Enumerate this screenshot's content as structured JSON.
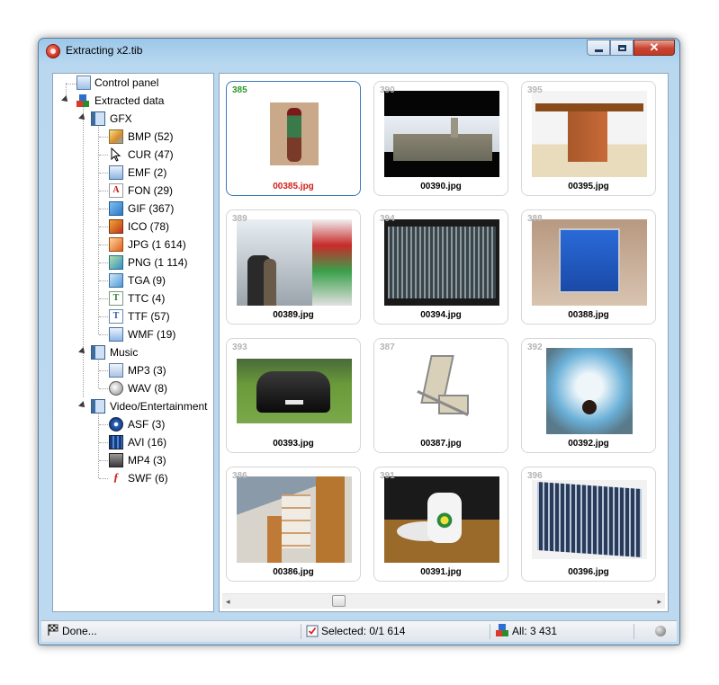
{
  "window": {
    "title": "Extracting x2.tib"
  },
  "tree": {
    "control_panel": "Control panel",
    "extracted_data": "Extracted data",
    "gfx": {
      "label": "GFX",
      "items": [
        "BMP (52)",
        "CUR (47)",
        "EMF (2)",
        "FON (29)",
        "GIF (367)",
        "ICO (78)",
        "JPG (1 614)",
        "PNG (1 114)",
        "TGA (9)",
        "TTC (4)",
        "TTF (57)",
        "WMF (19)"
      ]
    },
    "music": {
      "label": "Music",
      "items": [
        "MP3 (3)",
        "WAV (8)"
      ]
    },
    "video": {
      "label": "Video/Entertainment",
      "items": [
        "ASF (3)",
        "AVI (16)",
        "MP4 (3)",
        "SWF (6)"
      ]
    }
  },
  "thumbnails": [
    {
      "num": "385",
      "file": "00385.jpg",
      "selected": true
    },
    {
      "num": "389",
      "file": "00389.jpg"
    },
    {
      "num": "393",
      "file": "00393.jpg"
    },
    {
      "num": "386",
      "file": "00386.jpg"
    },
    {
      "num": "390",
      "file": "00390.jpg"
    },
    {
      "num": "394",
      "file": "00394.jpg"
    },
    {
      "num": "387",
      "file": "00387.jpg"
    },
    {
      "num": "391",
      "file": "00391.jpg"
    },
    {
      "num": "395",
      "file": "00395.jpg"
    },
    {
      "num": "388",
      "file": "00388.jpg"
    },
    {
      "num": "392",
      "file": "00392.jpg"
    },
    {
      "num": "396",
      "file": "00396.jpg"
    }
  ],
  "status": {
    "left": "Done...",
    "selected": "Selected: 0/1 614",
    "all": "All: 3 431"
  },
  "colors": {
    "selected_filename": "#d0201b",
    "selected_number": "#2a9a2a",
    "selection_border": "#3a79b8"
  }
}
